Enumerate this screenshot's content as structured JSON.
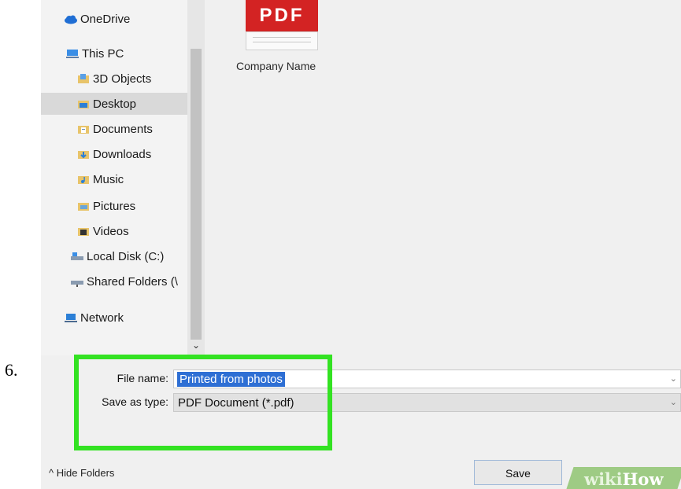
{
  "step": {
    "number": "6."
  },
  "nav": {
    "items": [
      {
        "label": "OneDrive",
        "icon": "cloud-icon"
      },
      {
        "label": "This PC",
        "icon": "computer-icon"
      },
      {
        "label": "3D Objects",
        "icon": "3d-objects-icon"
      },
      {
        "label": "Desktop",
        "icon": "desktop-folder-icon",
        "selected": true
      },
      {
        "label": "Documents",
        "icon": "documents-folder-icon"
      },
      {
        "label": "Downloads",
        "icon": "downloads-folder-icon"
      },
      {
        "label": "Music",
        "icon": "music-folder-icon"
      },
      {
        "label": "Pictures",
        "icon": "pictures-folder-icon"
      },
      {
        "label": "Videos",
        "icon": "videos-folder-icon"
      },
      {
        "label": "Local Disk (C:)",
        "icon": "drive-icon"
      },
      {
        "label": "Shared Folders (\\",
        "icon": "network-drive-icon"
      },
      {
        "label": "Network",
        "icon": "network-icon"
      }
    ],
    "scroll_down_glyph": "⌄"
  },
  "content": {
    "file": {
      "icon_text": "PDF",
      "name": "Company Name"
    }
  },
  "form": {
    "filename_label": "File name:",
    "filename_value": "Printed from photos",
    "type_label": "Save as type:",
    "type_value": "PDF Document (*.pdf)",
    "dropdown_glyph": "⌄"
  },
  "footer": {
    "hide_folders": "^ Hide Folders",
    "save": "Save"
  },
  "watermark": {
    "part1": "wiki",
    "part2": "How"
  },
  "colors": {
    "highlight": "#33e222",
    "selection": "#2e6fd4",
    "pdf_red": "#d32323",
    "selected_row": "#d9d9d9"
  }
}
